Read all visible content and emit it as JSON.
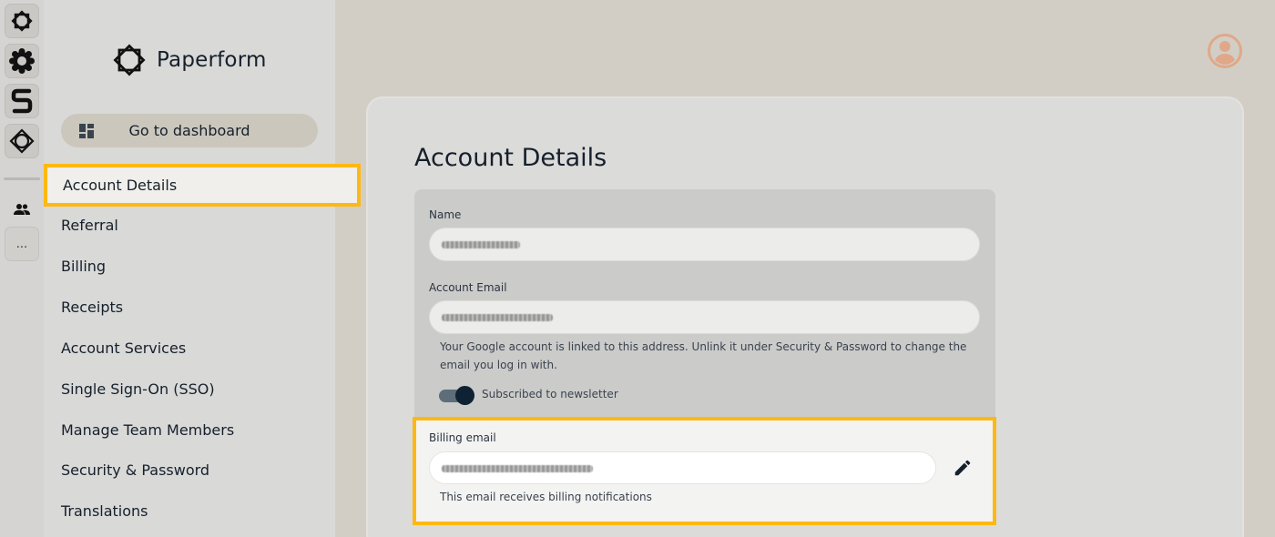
{
  "brand": {
    "name": "Paperform"
  },
  "rail": {
    "apps": [
      "paperform-app-icon",
      "gear-app-icon",
      "stepper-app-icon",
      "diamond-app-icon"
    ],
    "team_icon": "team-icon",
    "more_label": "..."
  },
  "sidebar": {
    "dashboard_label": "Go to dashboard",
    "items": [
      {
        "label": "Account Details",
        "active": true
      },
      {
        "label": "Referral"
      },
      {
        "label": "Billing"
      },
      {
        "label": "Receipts"
      },
      {
        "label": "Account Services"
      },
      {
        "label": "Single Sign-On (SSO)"
      },
      {
        "label": "Manage Team Members"
      },
      {
        "label": "Security & Password"
      },
      {
        "label": "Translations"
      }
    ]
  },
  "main": {
    "title": "Account Details",
    "name_label": "Name",
    "account_email_label": "Account Email",
    "account_email_help": "Your Google account is linked to this address. Unlink it under Security & Password to change the email you log in with.",
    "newsletter_label": "Subscribed to newsletter",
    "newsletter_on": true,
    "billing_label": "Billing email",
    "billing_help": "This email receives billing notifications"
  },
  "colors": {
    "highlight": "#fdb813",
    "avatar": "#e0a889",
    "toggle_knob": "#0e2233"
  }
}
